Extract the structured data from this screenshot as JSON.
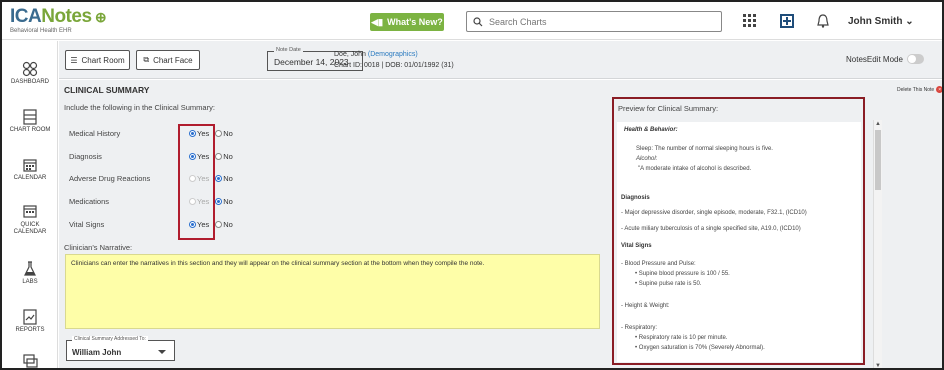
{
  "app": {
    "logo_main": "ICANotes",
    "logo_sub": "Behavioral Health EHR",
    "whats_new_label": "What's New?",
    "search_placeholder": "Search Charts",
    "user_name": "John Smith"
  },
  "sidenav": {
    "items": [
      {
        "label": "DASHBOARD",
        "icon": "dashboard-icon"
      },
      {
        "label": "CHART ROOM",
        "icon": "chart-room-icon"
      },
      {
        "label": "CALENDAR",
        "icon": "calendar-icon"
      },
      {
        "label": "QUICK CALENDAR",
        "icon": "quick-calendar-icon"
      },
      {
        "label": "LABS",
        "icon": "labs-icon"
      },
      {
        "label": "REPORTS",
        "icon": "reports-icon"
      }
    ]
  },
  "header": {
    "chart_room_btn": "Chart Room",
    "chart_face_btn": "Chart Face",
    "note_date_legend": "Note Date",
    "note_date": "December 14, 2023",
    "patient_name": "Doe, John",
    "demographics_link": "(Demographics)",
    "chart_line": "Chart ID: 0018 | DOB: 01/01/1992 (31)",
    "edit_mode_label": "NotesEdit Mode"
  },
  "main": {
    "title": "CLINICAL SUMMARY",
    "delete_label": "Delete This Note",
    "instructions": "Include the following in the Clinical Summary:",
    "yes_label": "Yes",
    "no_label": "No",
    "questions": [
      {
        "label": "Medical History",
        "selected": "yes"
      },
      {
        "label": "Diagnosis",
        "selected": "yes"
      },
      {
        "label": "Adverse Drug Reactions",
        "selected": "no"
      },
      {
        "label": "Medications",
        "selected": "no"
      },
      {
        "label": "Vital Signs",
        "selected": "yes"
      }
    ],
    "narrative_label": "Clinician's Narrative:",
    "narrative_text": "Clinicians can enter the narratives in this section and they will appear on the clinical summary section at the bottom when they compile the note.",
    "addressed_legend": "Clinical Summary Addressed To:",
    "addressed_value": "William John"
  },
  "preview": {
    "label": "Preview for Clinical Summary:",
    "lines": {
      "health_behavior": "Health & Behavior:",
      "sleep_label": "Sleep:",
      "sleep_text": "The number of normal sleeping hours is five.",
      "alcohol_label": "Alcohol:",
      "alcohol_text": "\"A moderate intake of alcohol is described.",
      "diagnosis_head": "Diagnosis",
      "dx1": "- Major depressive disorder, single episode, moderate, F32.1, (ICD10)",
      "dx2": "- Acute miliary tuberculosis of a single specified site, A19.0, (ICD10)",
      "vitals_head": "Vital Signs",
      "bp_pulse": "- Blood Pressure and Pulse:",
      "bp": "Supine blood pressure is 100 / 55.",
      "pulse": "Supine pulse rate is 50.",
      "height_weight": "- Height & Weight:",
      "respiratory": "- Respiratory:",
      "resp_rate": "Respiratory rate is 10 per minute.",
      "oxygen": "Oxygen saturation is 70% (Severely Abnormal)."
    }
  },
  "colors": {
    "accent_green": "#7cb342",
    "radio_blue": "#2a6fce",
    "highlight_red": "#b01c2e",
    "narrative_yellow": "#fefea8"
  }
}
